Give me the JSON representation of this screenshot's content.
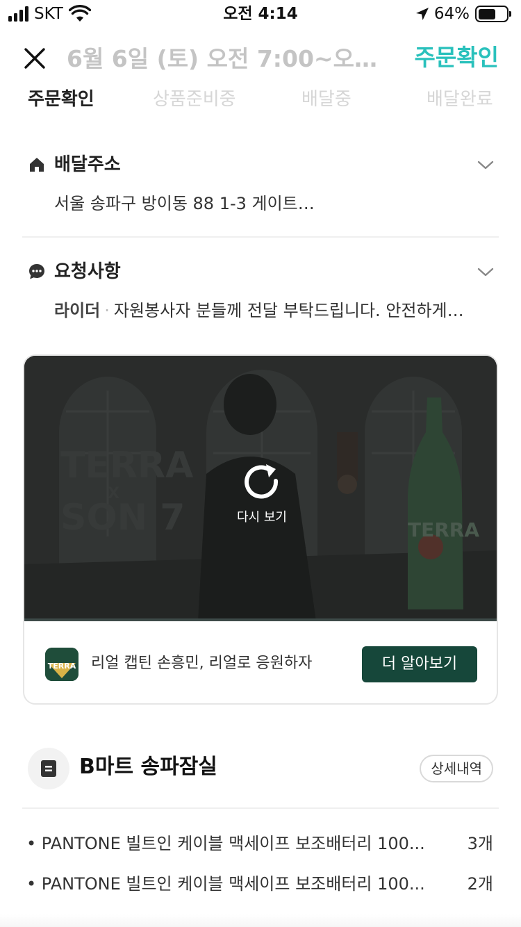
{
  "status_bar": {
    "carrier": "SKT",
    "time": "오전 4:14",
    "battery_percent": "64%",
    "battery_level": 0.64
  },
  "header": {
    "title": "6월 6일 (토) 오전 7:00~오전...",
    "status": "주문확인"
  },
  "steps": [
    "주문확인",
    "상품준비중",
    "배달중",
    "배달완료"
  ],
  "address": {
    "title": "배달주소",
    "value": "서울 송파구 방이동 88 1-3 게이트…"
  },
  "request": {
    "title": "요청사항",
    "target": "라이더",
    "separator": "·",
    "value": "자원봉사자 분들께 전달 부탁드립니다. 안전하게…"
  },
  "ad": {
    "replay_label": "다시 보기",
    "text": "리얼 캡틴 손흥민, 리얼로 응원하자",
    "cta": "더 알아보기",
    "video_brand_text": "TERRA",
    "video_collab_x": "X",
    "video_collab_text": "SON 7",
    "logo_text": "TERRA"
  },
  "store": {
    "name": "B마트 송파잠실",
    "detail_label": "상세내역"
  },
  "items": [
    {
      "name": "PANTONE 빌트인 케이블 맥세이프 보조배터리 100...",
      "qty": "3개"
    },
    {
      "name": "PANTONE 빌트인 케이블 맥세이프 보조배터리 100...",
      "qty": "2개"
    }
  ],
  "colors": {
    "accent": "#2ac1bc",
    "cta": "#16473a",
    "inactive_step": "#d6d6d6"
  },
  "icons": {
    "close": "close-icon",
    "home": "home-icon",
    "chat": "chat-bubble-icon",
    "chevron": "chevron-down-icon",
    "replay": "replay-icon",
    "store": "receipt-icon"
  }
}
